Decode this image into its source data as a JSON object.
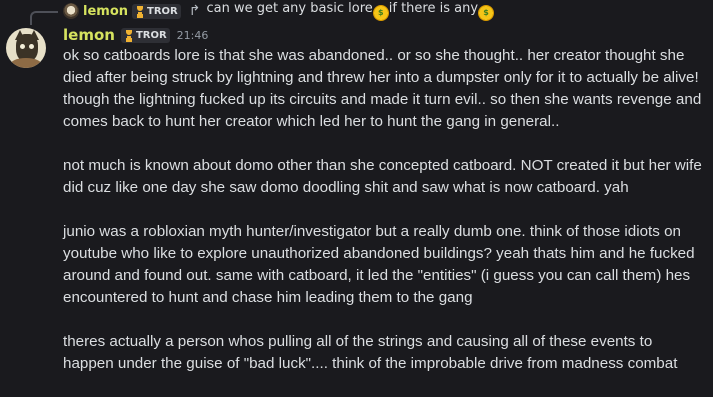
{
  "reply": {
    "username": "lemon",
    "tag": "TROR",
    "text_before": "can we get any basic lore",
    "text_middle": "if there is any",
    "emoji": "money-mouth-face"
  },
  "message": {
    "username": "lemon",
    "tag": "TROR",
    "timestamp": "21:46",
    "paragraphs": [
      "ok so catboards lore is that she was abandoned.. or so she thought.. her creator thought she died after being struck by lightning and threw her into a dumpster only for it to actually be alive! though the lightning fucked up its circuits and made it turn evil.. so then she wants revenge and comes back to hunt her creator which led her to hunt the gang in general..",
      "not much is known about domo other than she concepted catboard. NOT created it but her wife did cuz like one day she saw domo doodling shit and saw what is now catboard. yah",
      "junio was a robloxian myth hunter/investigator but a really dumb one. think of those idiots on youtube who like to explore unauthorized abandoned buildings? yeah thats him and he fucked around and found out. same with catboard, it led the \"entities\" (i guess you can call them) hes encountered to hunt and chase him leading them to the gang",
      "theres actually a person whos pulling all of the strings and causing all of these events to happen under the guise of \"bad luck\".... think of the improbable drive from madness combat"
    ]
  },
  "colors": {
    "background": "#1a1a1e",
    "username": "#d6e35f",
    "text": "#dbdee1",
    "muted": "#949ba4",
    "trophy": "#f0b232"
  }
}
